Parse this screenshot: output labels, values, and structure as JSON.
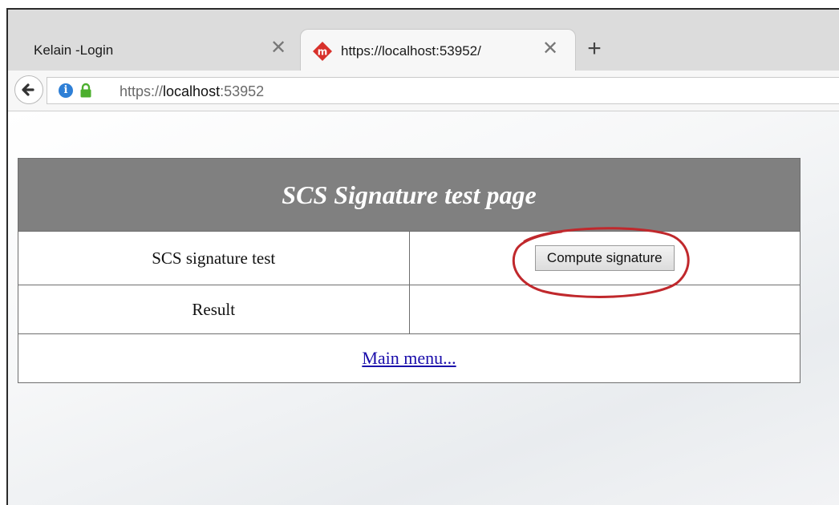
{
  "browser": {
    "tabs": [
      {
        "title": "Kelain -Login",
        "close_glyph": "✕",
        "active": false
      },
      {
        "title": "https://localhost:53952/",
        "close_glyph": "✕",
        "active": true,
        "favicon": "red-diamond-m-icon"
      }
    ],
    "new_tab_glyph": "+",
    "address": {
      "scheme": "https://",
      "host": "localhost",
      "port": ":53952",
      "info_glyph": "i"
    }
  },
  "page": {
    "header": "SCS Signature test page",
    "rows": [
      {
        "label": "SCS signature test",
        "button_label": "Compute signature"
      },
      {
        "label": "Result",
        "value": ""
      }
    ],
    "main_menu_link": "Main menu..."
  },
  "colors": {
    "header_bg": "#808080",
    "annotation_circle": "#c0282c",
    "lock_green": "#4caf2e",
    "info_blue": "#2e7fd6"
  }
}
